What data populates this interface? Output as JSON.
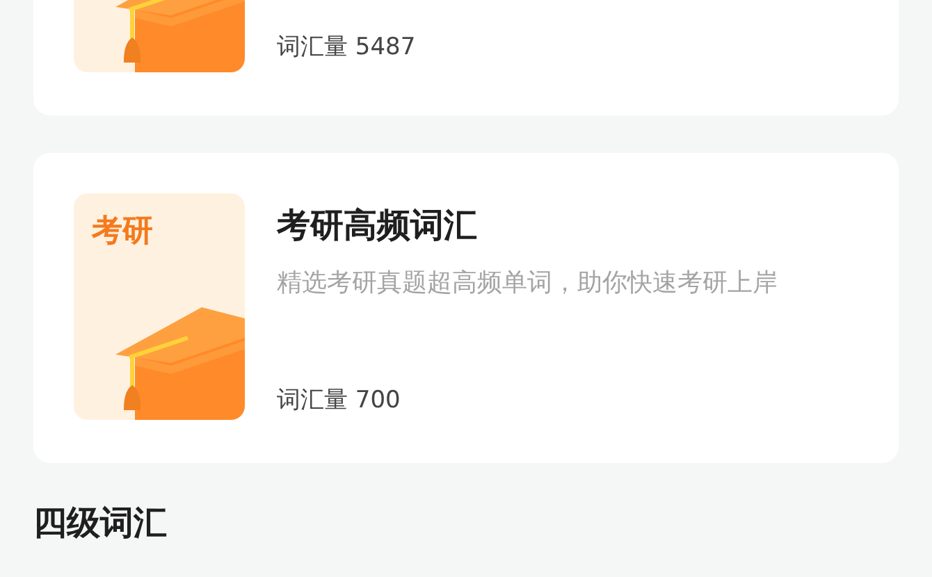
{
  "cards": [
    {
      "count": "词汇量 5487"
    },
    {
      "cover_label": "考研",
      "title": "考研高频词汇",
      "description": "精选考研真题超高频单词，助你快速考研上岸",
      "count": "词汇量 700"
    }
  ],
  "section_heading": "四级词汇"
}
